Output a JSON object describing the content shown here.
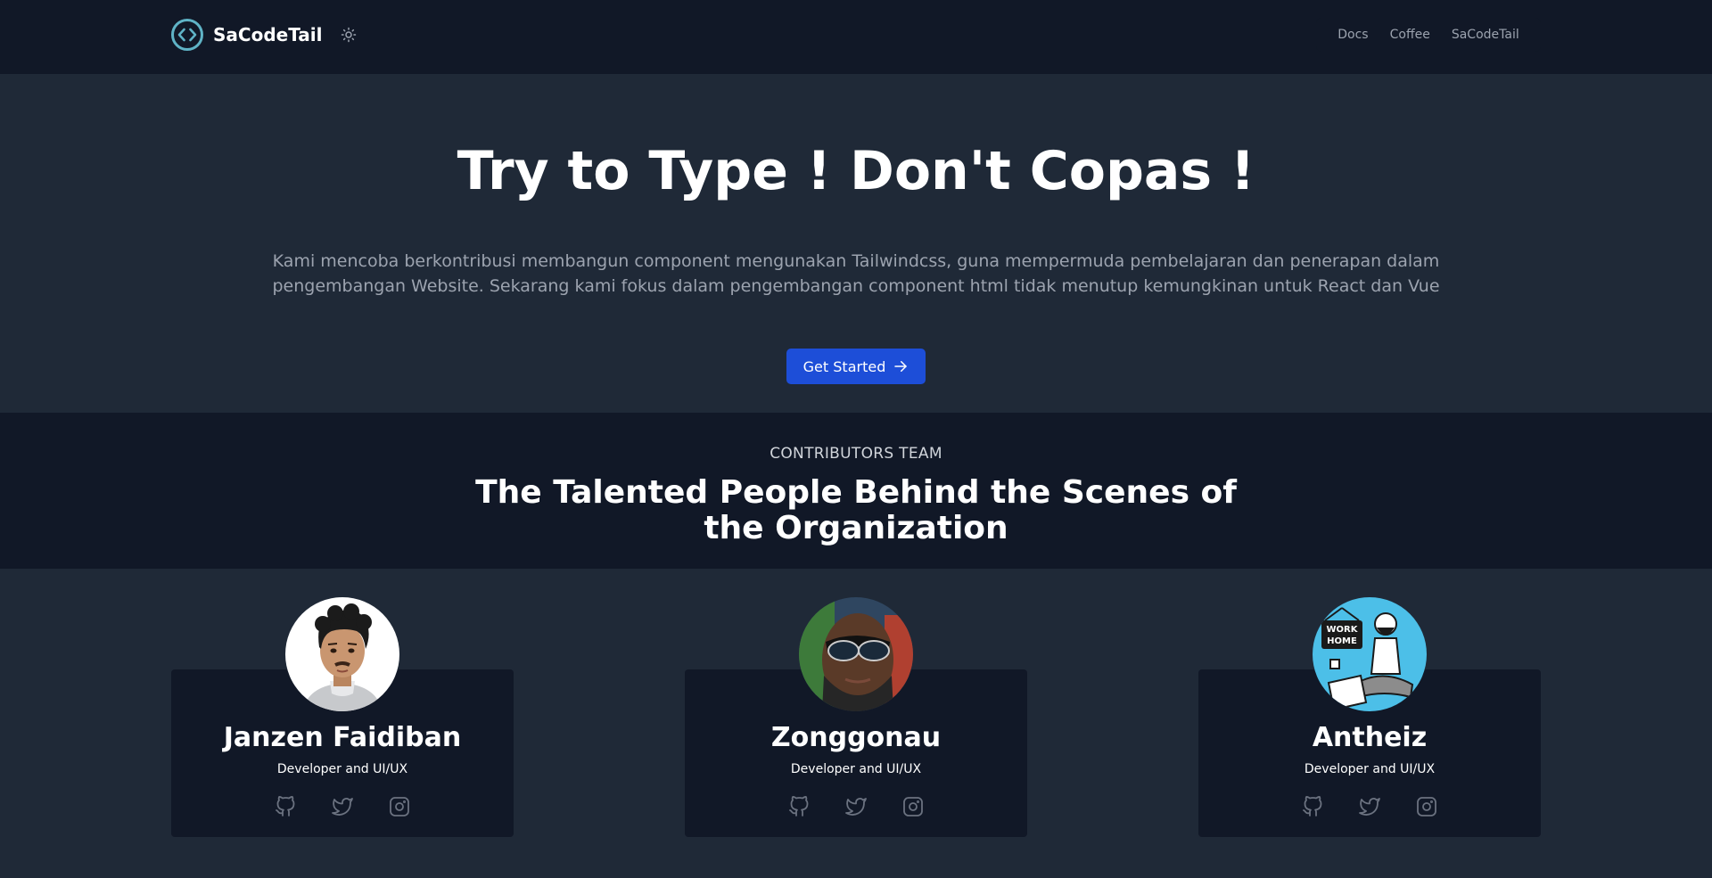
{
  "header": {
    "brand": "SaCodeTail",
    "nav": [
      "Docs",
      "Coffee",
      "SaCodeTail"
    ]
  },
  "hero": {
    "title": "Try to Type ! Don't Copas !",
    "description": "Kami mencoba berkontribusi membangun component mengunakan Tailwindcss, guna mempermuda pembelajaran dan penerapan dalam pengembangan Website. Sekarang kami fokus dalam pengembangan component html tidak menutup kemungkinan untuk React dan Vue",
    "cta_label": "Get Started"
  },
  "team": {
    "eyebrow": "CONTRIBUTORS TEAM",
    "heading": "The Talented People Behind the Scenes of the Organization",
    "members": [
      {
        "name": "Janzen Faidiban",
        "role": "Developer and UI/UX"
      },
      {
        "name": "Zonggonau",
        "role": "Developer and UI/UX"
      },
      {
        "name": "Antheiz",
        "role": "Developer and UI/UX"
      }
    ]
  },
  "colors": {
    "page_bg": "#1f2937",
    "header_bg": "#111827",
    "accent": "#1d4ed8",
    "logo": "#5fb3c6",
    "muted_text": "#9ca3af"
  },
  "icons": [
    "code-logo-icon",
    "sun-icon",
    "arrow-right-icon",
    "github-icon",
    "twitter-icon",
    "instagram-icon"
  ]
}
